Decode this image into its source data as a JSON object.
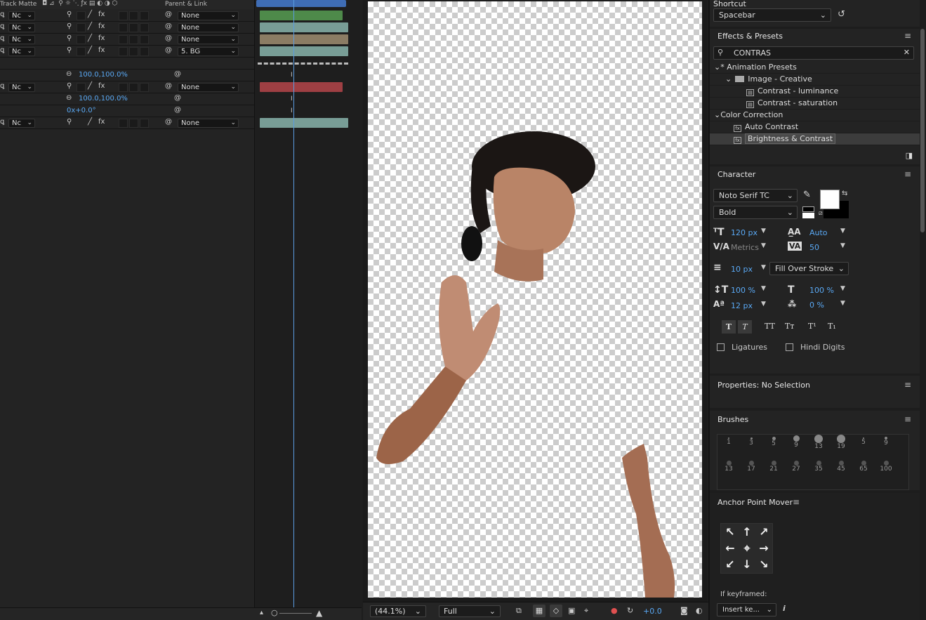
{
  "timeline": {
    "header": {
      "track_matte": "Track Matte",
      "parent_link": "Parent & Link"
    },
    "rows": [
      {
        "matte": "Nc",
        "parent": "None",
        "bar_color": "#4e8a4a"
      },
      {
        "matte": "Nc",
        "parent": "None",
        "bar_color": "#789d96"
      },
      {
        "matte": "Nc",
        "parent": "None",
        "bar_color": "#8b7c64"
      },
      {
        "matte": "Nc",
        "parent": "5. BG",
        "bar_color": "#789d96"
      }
    ],
    "scale_1": "100.0,100.0%",
    "row5": {
      "matte": "Nc",
      "parent": "None",
      "bar_color": "#9e3f43"
    },
    "scale_2": "100.0,100.0%",
    "rotation": "0x+0.0°",
    "row6": {
      "matte": "Nc",
      "parent": "None",
      "bar_color": "#789d96"
    }
  },
  "viewer": {
    "zoom": "(44.1%)",
    "resolution": "Full",
    "exposure": "+0.0"
  },
  "shortcut": {
    "label": "Shortcut",
    "value": "Spacebar"
  },
  "effects": {
    "title": "Effects & Presets",
    "search": "CONTRAS",
    "tree": [
      {
        "label": "* Animation Presets",
        "indent": 0,
        "type": "folder-open"
      },
      {
        "label": "Image - Creative",
        "indent": 1,
        "type": "folder"
      },
      {
        "label": "Contrast - luminance",
        "indent": 2,
        "type": "preset"
      },
      {
        "label": "Contrast - saturation",
        "indent": 2,
        "type": "preset"
      },
      {
        "label": "Color Correction",
        "indent": 0,
        "type": "folder-open"
      },
      {
        "label": "Auto Contrast",
        "indent": 1,
        "type": "effect"
      },
      {
        "label": "Brightness & Contrast",
        "indent": 1,
        "type": "effect",
        "selected": true
      }
    ]
  },
  "character": {
    "title": "Character",
    "font": "Noto Serif TC",
    "style": "Bold",
    "size": "120 px",
    "leading": "Auto",
    "kerning": "Metrics",
    "tracking": "50",
    "stroke_width": "10 px",
    "stroke_mode": "Fill Over Stroke",
    "vscale": "100 %",
    "hscale": "100 %",
    "baseline": "12 px",
    "tsume": "0 %",
    "ligatures": "Ligatures",
    "hindi_digits": "Hindi Digits",
    "fill_color": "#ffffff",
    "stroke_color": "#000000"
  },
  "properties": {
    "title": "Properties: No Selection"
  },
  "brushes": {
    "title": "Brushes",
    "row1": [
      "1",
      "3",
      "5",
      "9",
      "13",
      "19",
      "5",
      "9"
    ],
    "row2": [
      "13",
      "17",
      "21",
      "27",
      "35",
      "45",
      "65",
      "100"
    ]
  },
  "anchor": {
    "title": "Anchor Point Mover",
    "keyframed_label": "If keyframed:",
    "keyframed_value": "Insert ke..."
  }
}
